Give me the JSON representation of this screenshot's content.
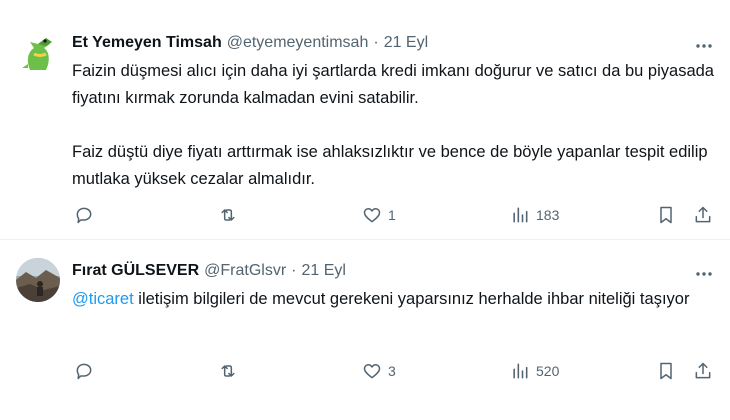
{
  "tweets": [
    {
      "author_name": "Et Yemeyen Timsah",
      "handle": "@etyemeyentimsah",
      "separator": "·",
      "date": "21 Eyl",
      "paragraphs": [
        "Faizin düşmesi alıcı için daha iyi şartlarda kredi imkanı doğurur ve satıcı da bu piyasada fiyatını kırmak zorunda kalmadan evini satabilir.",
        "Faiz düştü diye fiyatı arttırmak ise ahlaksızlıktır ve bence de böyle yapanlar tespit edilip mutlaka yüksek cezalar almalıdır."
      ],
      "avatar_icon": "green-crocodile-avatar",
      "stats": {
        "replies": "",
        "retweets": "",
        "likes": "1",
        "views": "183"
      }
    },
    {
      "author_name": "Fırat GÜLSEVER",
      "handle": "@FratGlsvr",
      "separator": "·",
      "date": "21 Eyl",
      "mention": "@ticaret",
      "text": " iletişim bilgileri de mevcut gerekeni yaparsınız herhalde ihbar niteliği taşıyor",
      "avatar_icon": "landscape-photo-avatar",
      "stats": {
        "replies": "",
        "retweets": "",
        "likes": "3",
        "views": "520"
      }
    }
  ],
  "colors": {
    "text": "#0f1419",
    "secondary": "#536471",
    "link": "#1d9bf0",
    "divider": "#eff3f4"
  }
}
